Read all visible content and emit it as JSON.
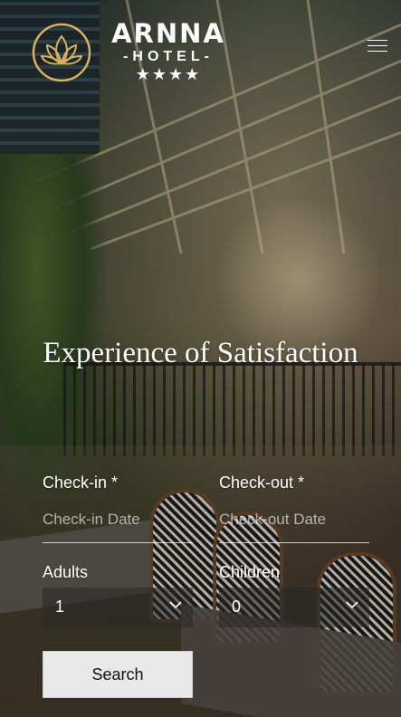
{
  "brand": {
    "name": "ARNNA",
    "subtitle": "-HOTEL-",
    "stars": "★★★★"
  },
  "header": {
    "menu_icon": "hamburger-menu-icon",
    "logo_icon": "lotus-logo-icon"
  },
  "hero": {
    "headline": "Experience of Satisfaction"
  },
  "booking": {
    "checkin_label": "Check-in *",
    "checkin_placeholder": "Check-in Date",
    "checkout_label": "Check-out *",
    "checkout_placeholder": "Check-out Date",
    "adults_label": "Adults",
    "adults_value": "1",
    "children_label": "Children",
    "children_value": "0",
    "search_label": "Search"
  },
  "colors": {
    "accent_gold": "#d8b25a",
    "button_bg": "#e8e8e8"
  }
}
